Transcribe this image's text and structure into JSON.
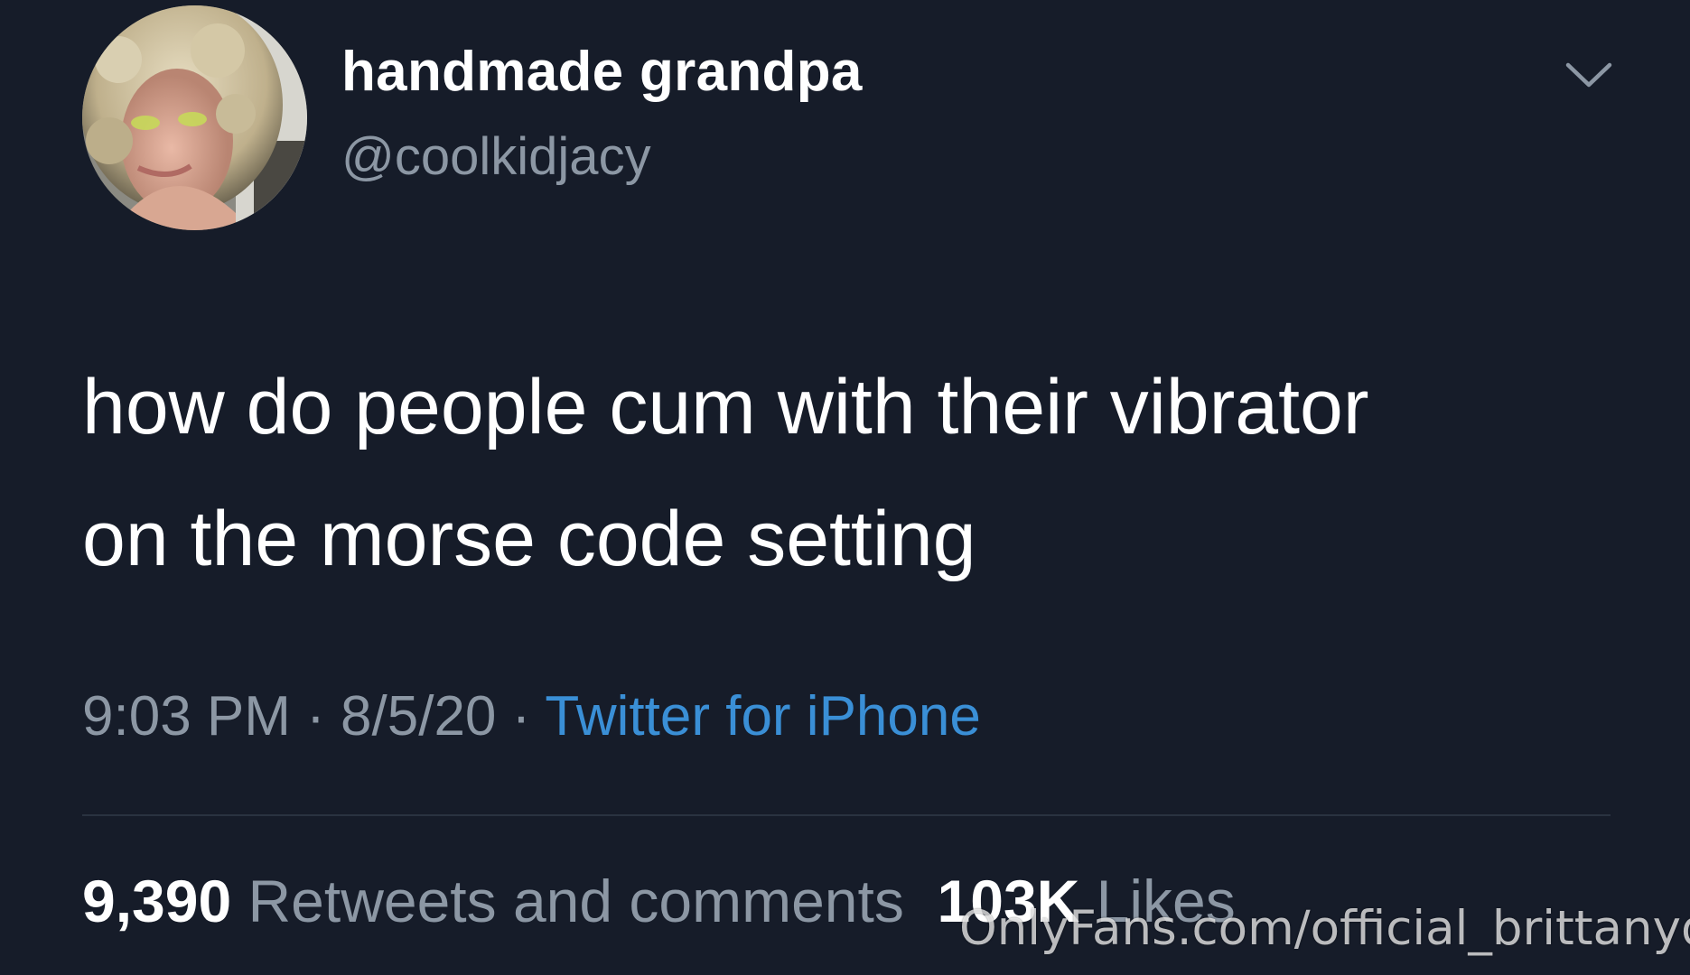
{
  "author": {
    "display_name": "handmade grandpa",
    "handle": "@coolkidjacy"
  },
  "tweet": {
    "text_lines": [
      "how do people cum with their vibrator",
      "on the morse code setting"
    ],
    "time": "9:03 PM",
    "date": "8/5/20",
    "separator": "·",
    "source": "Twitter for iPhone"
  },
  "stats": {
    "retweets_count": "9,390",
    "retweets_label": "Retweets and comments",
    "likes_count": "103K",
    "likes_label": "Likes"
  },
  "watermark": "OnlyFans.com/official_brittanyd",
  "colors": {
    "background": "#161c29",
    "secondary_text": "#8c97a4",
    "link": "#3a8fd6"
  },
  "icons": {
    "caret": "chevron-down-icon",
    "avatar": "profile-photo"
  }
}
